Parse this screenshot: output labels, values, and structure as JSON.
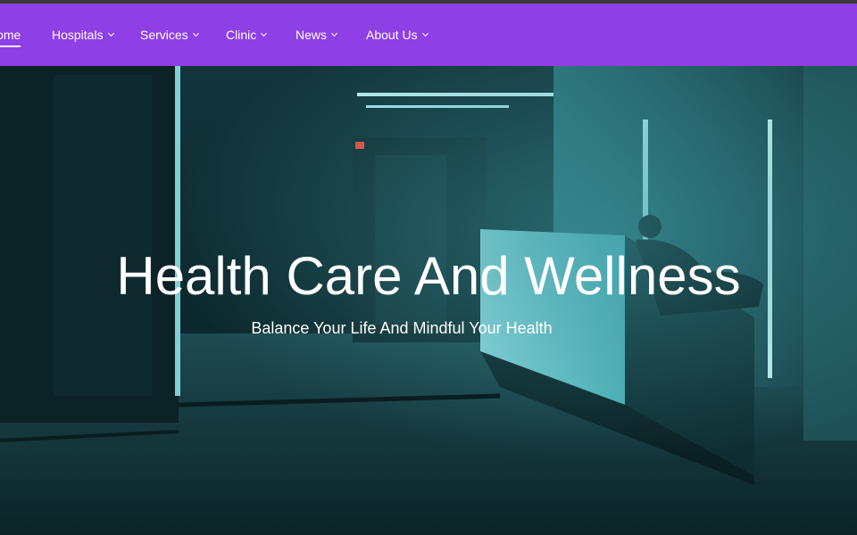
{
  "nav": {
    "items": [
      {
        "label": "Home",
        "active": true,
        "has_dropdown": false
      },
      {
        "label": "Hospitals",
        "active": false,
        "has_dropdown": true
      },
      {
        "label": "Services",
        "active": false,
        "has_dropdown": true
      },
      {
        "label": "Clinic",
        "active": false,
        "has_dropdown": true
      },
      {
        "label": "News",
        "active": false,
        "has_dropdown": true
      },
      {
        "label": "About Us",
        "active": false,
        "has_dropdown": true
      }
    ],
    "background": "#8e3fe6"
  },
  "hero": {
    "title": "Health Care And Wellness",
    "subtitle": "Balance Your Life And Mindful Your Health",
    "image_subject": "dim hospital corridor with reception desk"
  }
}
